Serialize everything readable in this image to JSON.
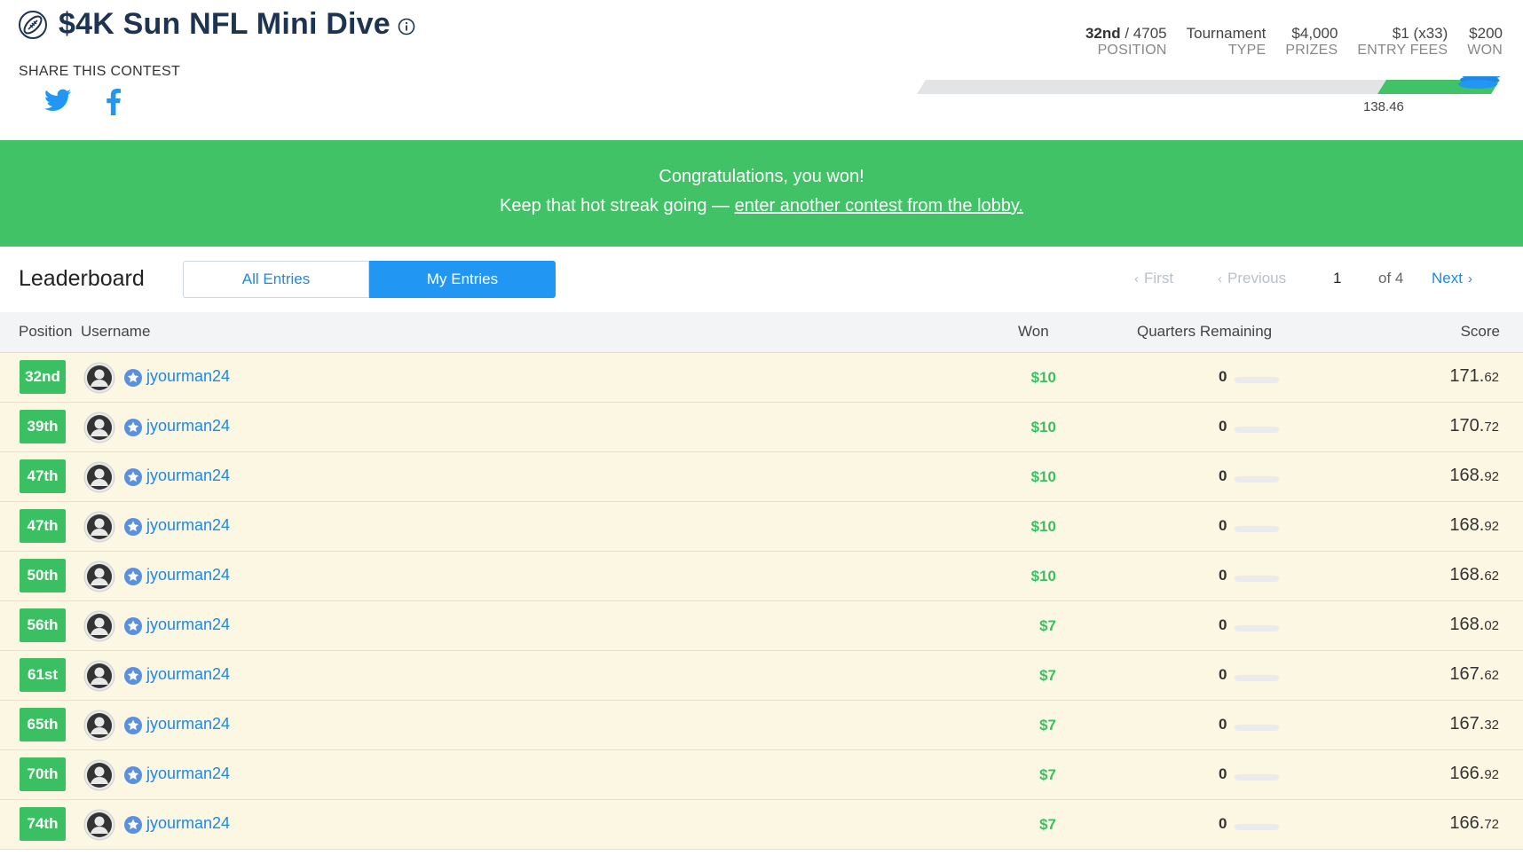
{
  "contest": {
    "title": "$4K Sun NFL Mini Dive",
    "share_label": "SHARE THIS CONTEST"
  },
  "stats": {
    "position_value": "32nd",
    "position_total": " / 4705",
    "position_label": "POSITION",
    "type_value": "Tournament",
    "type_label": "TYPE",
    "prizes_value": "$4,000",
    "prizes_label": "PRIZES",
    "entry_value": "$1 (x33)",
    "entry_label": "ENTRY FEES",
    "won_value": "$200",
    "won_label": "WON"
  },
  "progress": {
    "value_label": "138.46",
    "fill_fraction": 0.21
  },
  "banner": {
    "line1": "Congratulations, you won!",
    "line2_prefix": "Keep that hot streak going — ",
    "line2_link": "enter another contest from the lobby."
  },
  "leaderboard": {
    "title": "Leaderboard",
    "tabs": [
      "All Entries",
      "My Entries"
    ],
    "active_tab": "My Entries",
    "pager": {
      "first": "First",
      "previous": "Previous",
      "current_page": "1",
      "of_pages": "of 4",
      "next": "Next"
    },
    "columns": {
      "position": "Position",
      "username": "Username",
      "won": "Won",
      "quarters": "Quarters Remaining",
      "score": "Score"
    },
    "rows": [
      {
        "position": "32nd",
        "username": "jyourman24",
        "won": "$10",
        "quarters": "0",
        "score_int": "171.",
        "score_dec": "62"
      },
      {
        "position": "39th",
        "username": "jyourman24",
        "won": "$10",
        "quarters": "0",
        "score_int": "170.",
        "score_dec": "72"
      },
      {
        "position": "47th",
        "username": "jyourman24",
        "won": "$10",
        "quarters": "0",
        "score_int": "168.",
        "score_dec": "92"
      },
      {
        "position": "47th",
        "username": "jyourman24",
        "won": "$10",
        "quarters": "0",
        "score_int": "168.",
        "score_dec": "92"
      },
      {
        "position": "50th",
        "username": "jyourman24",
        "won": "$10",
        "quarters": "0",
        "score_int": "168.",
        "score_dec": "62"
      },
      {
        "position": "56th",
        "username": "jyourman24",
        "won": "$7",
        "quarters": "0",
        "score_int": "168.",
        "score_dec": "02"
      },
      {
        "position": "61st",
        "username": "jyourman24",
        "won": "$7",
        "quarters": "0",
        "score_int": "167.",
        "score_dec": "62"
      },
      {
        "position": "65th",
        "username": "jyourman24",
        "won": "$7",
        "quarters": "0",
        "score_int": "167.",
        "score_dec": "32"
      },
      {
        "position": "70th",
        "username": "jyourman24",
        "won": "$7",
        "quarters": "0",
        "score_int": "166.",
        "score_dec": "92"
      },
      {
        "position": "74th",
        "username": "jyourman24",
        "won": "$7",
        "quarters": "0",
        "score_int": "166.",
        "score_dec": "72"
      }
    ]
  },
  "colors": {
    "brand_navy": "#1d3352",
    "banner_green": "#41c266",
    "badge_green": "#3bbf63",
    "link_blue": "#1e88e5",
    "row_bg": "#fbf7e3"
  }
}
